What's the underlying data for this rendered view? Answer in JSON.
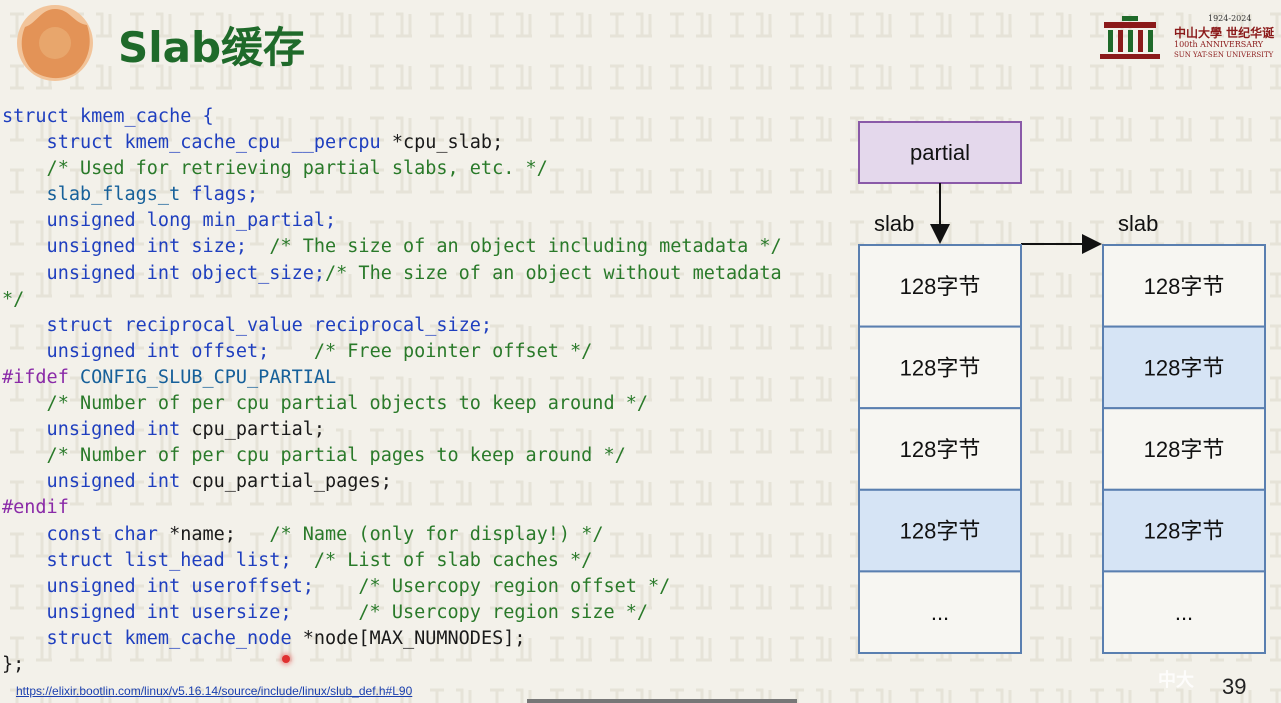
{
  "slide": {
    "title": "Slab缓存",
    "page_number": "39",
    "source_link": "https://elixir.bootlin.com/linux/v5.16.14/source/include/linux/slub_def.h#L90"
  },
  "university_logo": {
    "years": "1924-2024",
    "name": "中山大學 世纪华诞",
    "anniversary": "100th ANNIVERSARY",
    "english": "SUN YAT-SEN UNIVERSITY"
  },
  "code_lines": [
    [
      {
        "t": "struct kmem_cache {",
        "c": "kw"
      }
    ],
    [
      {
        "t": "    struct kmem_cache_cpu __percpu ",
        "c": "kw"
      },
      {
        "t": "*cpu_slab;",
        "c": ""
      }
    ],
    [
      {
        "t": "    /* Used for retrieving partial slabs, etc. */",
        "c": "cm"
      }
    ],
    [
      {
        "t": "    slab_flags_t ",
        "c": "tp"
      },
      {
        "t": "flags;",
        "c": "kw"
      }
    ],
    [
      {
        "t": "    unsigned long min_partial;",
        "c": "kw"
      }
    ],
    [
      {
        "t": "    unsigned int size;  ",
        "c": "kw"
      },
      {
        "t": "/* The size of an object including metadata */",
        "c": "cm"
      }
    ],
    [
      {
        "t": "    unsigned int object_size;",
        "c": "kw"
      },
      {
        "t": "/* The size of an object without metadata",
        "c": "cm"
      }
    ],
    [
      {
        "t": "*/",
        "c": "cm"
      }
    ],
    [
      {
        "t": "    struct reciprocal_value reciprocal_size;",
        "c": "kw"
      }
    ],
    [
      {
        "t": "    unsigned int offset;    ",
        "c": "kw"
      },
      {
        "t": "/* Free pointer offset */",
        "c": "cm"
      }
    ],
    [
      {
        "t": "#ifdef ",
        "c": "pp"
      },
      {
        "t": "CONFIG_SLUB_CPU_PARTIAL",
        "c": "tp"
      }
    ],
    [
      {
        "t": "    /* Number of per cpu partial objects to keep around */",
        "c": "cm"
      }
    ],
    [
      {
        "t": "    unsigned int ",
        "c": "kw"
      },
      {
        "t": "cpu_partial;",
        "c": ""
      }
    ],
    [
      {
        "t": "    /* Number of per cpu partial pages to keep around */",
        "c": "cm"
      }
    ],
    [
      {
        "t": "    unsigned int ",
        "c": "kw"
      },
      {
        "t": "cpu_partial_pages;",
        "c": ""
      }
    ],
    [
      {
        "t": "#endif",
        "c": "pp"
      }
    ],
    [
      {
        "t": "    const char ",
        "c": "kw"
      },
      {
        "t": "*name;   ",
        "c": ""
      },
      {
        "t": "/* Name (only for display!) */",
        "c": "cm"
      }
    ],
    [
      {
        "t": "    struct list_head list;  ",
        "c": "kw"
      },
      {
        "t": "/* List of slab caches */",
        "c": "cm"
      }
    ],
    [
      {
        "t": "    unsigned int useroffset;    ",
        "c": "kw"
      },
      {
        "t": "/* Usercopy region offset */",
        "c": "cm"
      }
    ],
    [
      {
        "t": "    unsigned int usersize;      ",
        "c": "kw"
      },
      {
        "t": "/* Usercopy region size */",
        "c": "cm"
      }
    ],
    [
      {
        "t": "    struct kmem_cache_node ",
        "c": "kw"
      },
      {
        "t": "*node[MAX_NUMNODES];",
        "c": ""
      }
    ],
    [
      {
        "t": "};",
        "c": ""
      }
    ]
  ],
  "diagram": {
    "partial_label": "partial",
    "slab_label_left": "slab",
    "slab_label_right": "slab",
    "left_slab": [
      {
        "label": "128字节",
        "highlight": false
      },
      {
        "label": "128字节",
        "highlight": false
      },
      {
        "label": "128字节",
        "highlight": false
      },
      {
        "label": "128字节",
        "highlight": true
      },
      {
        "label": "...",
        "highlight": false
      }
    ],
    "right_slab": [
      {
        "label": "128字节",
        "highlight": false
      },
      {
        "label": "128字节",
        "highlight": true
      },
      {
        "label": "128字节",
        "highlight": false
      },
      {
        "label": "128字节",
        "highlight": true
      },
      {
        "label": "...",
        "highlight": false
      }
    ],
    "colors": {
      "partial_fill": "#e4d8ec",
      "partial_stroke": "#8a5aa8",
      "cell_fill": "#f7f6f2",
      "highlight_fill": "#d6e4f5",
      "cell_stroke": "#5a7fb0"
    }
  }
}
